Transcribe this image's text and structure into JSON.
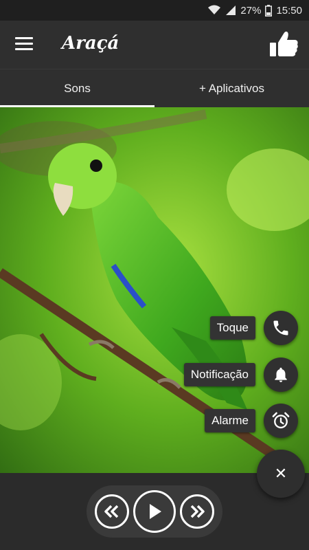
{
  "status_bar": {
    "battery": "27%",
    "time": "15:50",
    "icons": [
      "wifi-icon",
      "signal-icon",
      "battery-icon"
    ]
  },
  "app_bar": {
    "title": "Araçá",
    "menu_icon": "hamburger-menu-icon",
    "like_icon": "thumbs-up-icon"
  },
  "tabs": [
    {
      "label": "Sons",
      "active": true
    },
    {
      "label": "+ Aplicativos",
      "active": false
    }
  ],
  "photo": {
    "subject": "green-parakeet-on-branch"
  },
  "actions": [
    {
      "label": "Toque",
      "icon": "phone-icon"
    },
    {
      "label": "Notificação",
      "icon": "bell-icon"
    },
    {
      "label": "Alarme",
      "icon": "alarm-clock-icon"
    }
  ],
  "fab": {
    "icon": "close-icon",
    "symbol": "✕"
  },
  "player": {
    "previous_icon": "rewind-icon",
    "play_icon": "play-icon",
    "next_icon": "fast-forward-icon"
  },
  "colors": {
    "bar": "#2f2f2f",
    "background": "#2b2b2b",
    "foreground": "#ffffff"
  }
}
